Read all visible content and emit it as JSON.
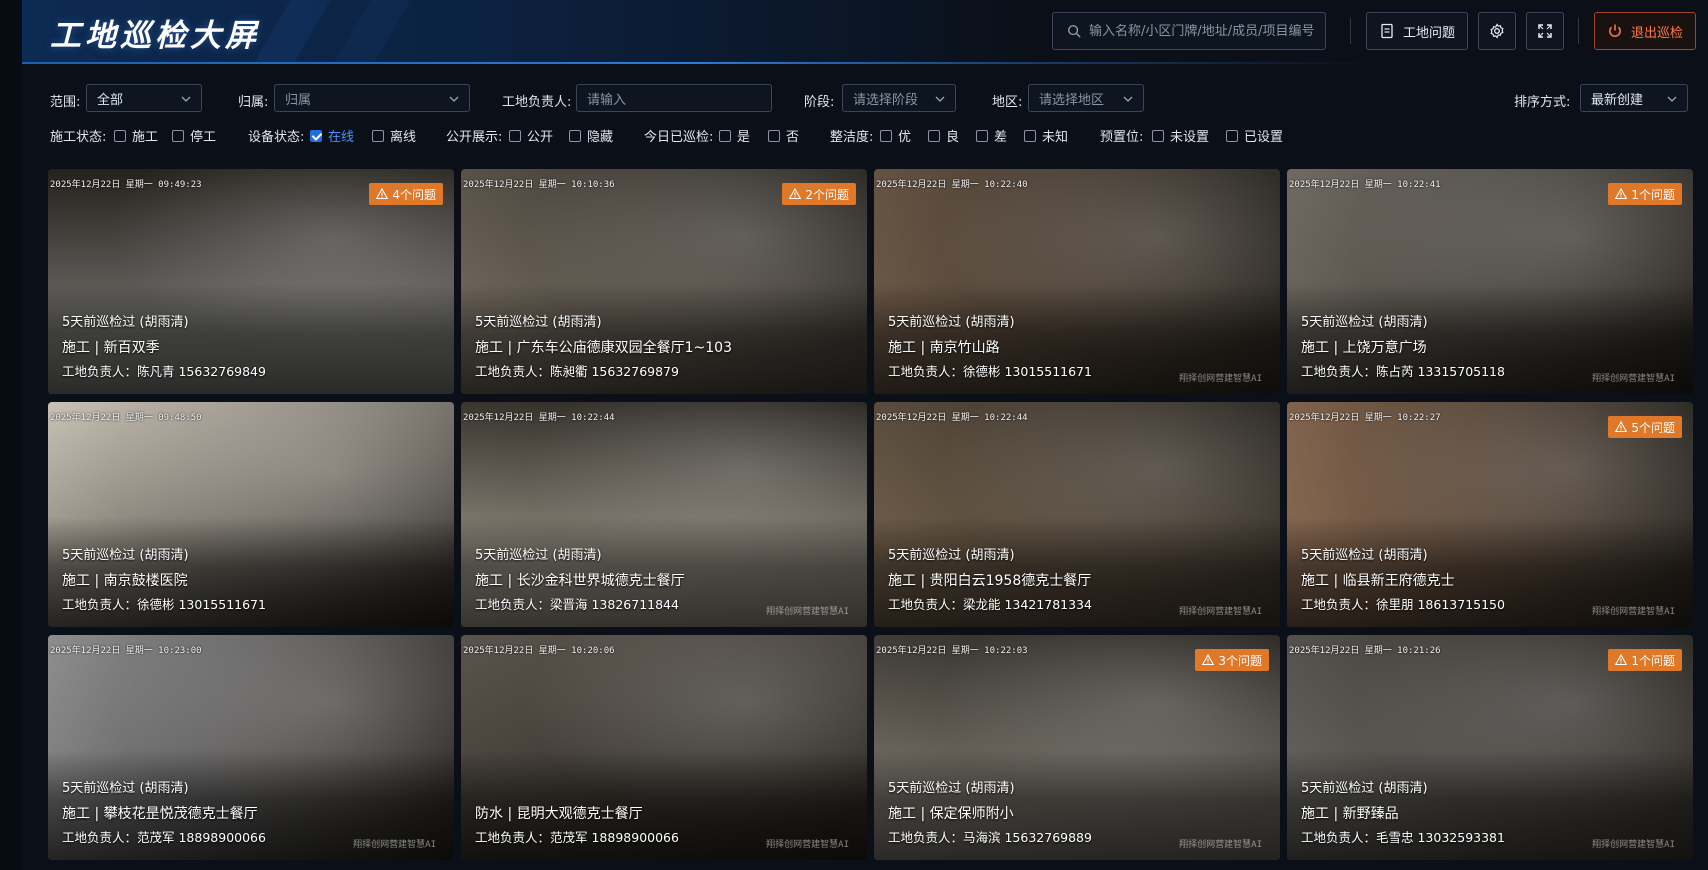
{
  "header": {
    "title": "工地巡检大屏",
    "search_placeholder": "输入名称/小区门牌/地址/成员/项目编号",
    "issues_button": "工地问题",
    "exit_button": "退出巡检"
  },
  "filters": {
    "scope": {
      "label": "范围:",
      "value": "全部"
    },
    "belong": {
      "label": "归属:",
      "placeholder": "归属"
    },
    "manager": {
      "label": "工地负责人:",
      "placeholder": "请输入"
    },
    "stage": {
      "label": "阶段:",
      "placeholder": "请选择阶段"
    },
    "region": {
      "label": "地区:",
      "placeholder": "请选择地区"
    },
    "sort": {
      "label": "排序方式:",
      "value": "最新创建"
    },
    "construction_status": {
      "label": "施工状态:",
      "options": [
        {
          "label": "施工",
          "checked": false
        },
        {
          "label": "停工",
          "checked": false
        }
      ]
    },
    "device_status": {
      "label": "设备状态:",
      "options": [
        {
          "label": "在线",
          "checked": true
        },
        {
          "label": "离线",
          "checked": false
        }
      ]
    },
    "public_display": {
      "label": "公开展示:",
      "options": [
        {
          "label": "公开",
          "checked": false
        },
        {
          "label": "隐藏",
          "checked": false
        }
      ]
    },
    "inspected_today": {
      "label": "今日已巡检:",
      "options": [
        {
          "label": "是",
          "checked": false
        },
        {
          "label": "否",
          "checked": false
        }
      ]
    },
    "tidiness": {
      "label": "整洁度:",
      "options": [
        {
          "label": "优",
          "checked": false
        },
        {
          "label": "良",
          "checked": false
        },
        {
          "label": "差",
          "checked": false
        },
        {
          "label": "未知",
          "checked": false
        }
      ]
    },
    "preset": {
      "label": "预置位:",
      "options": [
        {
          "label": "未设置",
          "checked": false
        },
        {
          "label": "已设置",
          "checked": false
        }
      ]
    }
  },
  "cards": [
    {
      "timestamp": "2025年12月22日 星期一 09:49:23",
      "badge": "4个问题",
      "inspected": "5天前巡检过 (胡雨清)",
      "site": "施工 | 新百双季",
      "manager": "工地负责人：陈凡青 15632769849",
      "watermark": ""
    },
    {
      "timestamp": "2025年12月22日 星期一 10:10:36",
      "badge": "2个问题",
      "inspected": "5天前巡检过 (胡雨清)",
      "site": "施工 | 广东车公庙德康双园全餐厅1~103",
      "manager": "工地负责人：陈昶衢 15632769879",
      "watermark": ""
    },
    {
      "timestamp": "2025年12月22日 星期一 10:22:40",
      "badge": "",
      "inspected": "5天前巡检过 (胡雨清)",
      "site": "施工 | 南京竹山路",
      "manager": "工地负责人：徐德彬 13015511671",
      "watermark": "翔择创网营建智慧AI"
    },
    {
      "timestamp": "2025年12月22日 星期一 10:22:41",
      "badge": "1个问题",
      "inspected": "5天前巡检过 (胡雨清)",
      "site": "施工 | 上饶万意广场",
      "manager": "工地负责人：陈占芮 13315705118",
      "watermark": "翔择创网营建智慧AI"
    },
    {
      "timestamp": "2025年12月22日 星期一 09:48:50",
      "badge": "",
      "inspected": "5天前巡检过 (胡雨清)",
      "site": "施工 | 南京鼓楼医院",
      "manager": "工地负责人：徐德彬 13015511671",
      "watermark": ""
    },
    {
      "timestamp": "2025年12月22日 星期一 10:22:44",
      "badge": "",
      "inspected": "5天前巡检过 (胡雨清)",
      "site": "施工 | 长沙金科世界城德克士餐厅",
      "manager": "工地负责人：梁晋海 13826711844",
      "watermark": "翔择创网营建智慧AI"
    },
    {
      "timestamp": "2025年12月22日 星期一 10:22:44",
      "badge": "",
      "inspected": "5天前巡检过 (胡雨清)",
      "site": "施工 | 贵阳白云1958德克士餐厅",
      "manager": "工地负责人：梁龙能 13421781334",
      "watermark": "翔择创网营建智慧AI"
    },
    {
      "timestamp": "2025年12月22日 星期一 10:22:27",
      "badge": "5个问题",
      "inspected": "5天前巡检过 (胡雨清)",
      "site": "施工 | 临县新王府德克士",
      "manager": "工地负责人：徐里朋 18613715150",
      "watermark": "翔择创网营建智慧AI"
    },
    {
      "timestamp": "2025年12月22日 星期一 10:23:00",
      "badge": "",
      "inspected": "5天前巡检过 (胡雨清)",
      "site": "施工 | 攀枝花昰悦茂德克士餐厅",
      "manager": "工地负责人：范茂军 18898900066",
      "watermark": "翔择创网营建智慧AI"
    },
    {
      "timestamp": "2025年12月22日 星期一 10:20:06",
      "badge": "",
      "inspected": "",
      "site": "防水 | 昆明大观德克士餐厅",
      "manager": "工地负责人：范茂军 18898900066",
      "watermark": "翔择创网营建智慧AI"
    },
    {
      "timestamp": "2025年12月22日 星期一 10:22:03",
      "badge": "3个问题",
      "inspected": "5天前巡检过 (胡雨清)",
      "site": "施工 | 保定保师附小",
      "manager": "工地负责人：马海滨 15632769889",
      "watermark": "翔择创网营建智慧AI"
    },
    {
      "timestamp": "2025年12月22日 星期一 10:21:26",
      "badge": "1个问题",
      "inspected": "5天前巡检过 (胡雨清)",
      "site": "施工 | 新野臻品",
      "manager": "工地负责人：毛雪忠 13032593381",
      "watermark": "翔择创网营建智慧AI"
    }
  ],
  "scene_colors": [
    "#8c8c88",
    "#7d7468",
    "#6e5a48",
    "#6f6a62",
    "#c9c2b6",
    "#b6aea0",
    "#7a6650",
    "#8a6a52",
    "#8e8e90",
    "#5a544c",
    "#8f8a80",
    "#6d6a66"
  ]
}
